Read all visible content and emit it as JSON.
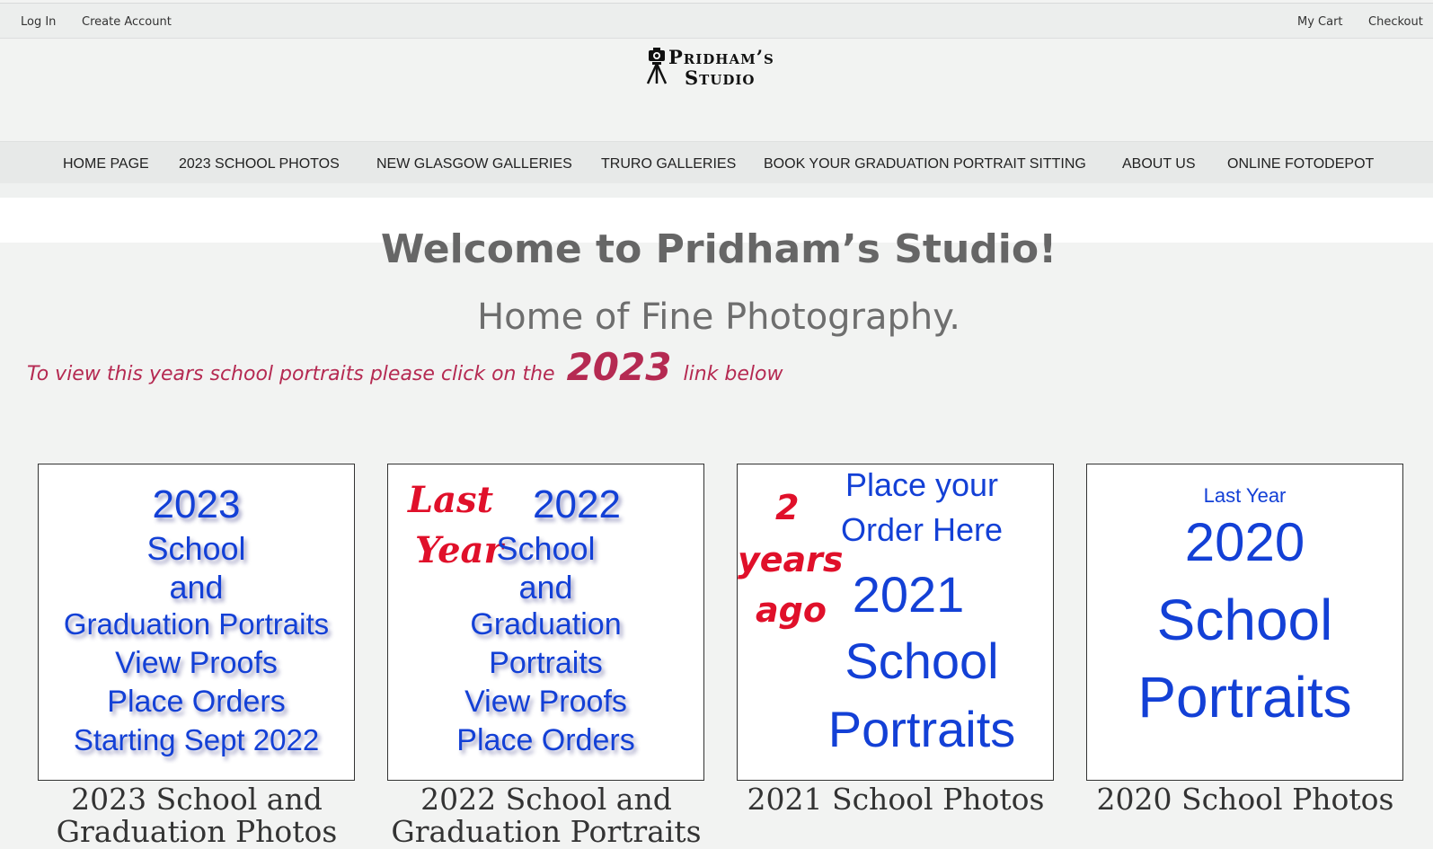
{
  "topbar": {
    "login": "Log In",
    "create_account": "Create Account",
    "cart": "My Cart",
    "checkout": "Checkout"
  },
  "logo": {
    "line1": "Pridham’s",
    "line2": "Studio"
  },
  "nav": [
    {
      "label": "HOME PAGE"
    },
    {
      "label": "2023 SCHOOL PHOTOS"
    },
    {
      "label": "NEW GLASGOW GALLERIES"
    },
    {
      "label": "TRURO GALLERIES"
    },
    {
      "label": "BOOK YOUR GRADUATION PORTRAIT SITTING"
    },
    {
      "label": "ABOUT US"
    },
    {
      "label": "ONLINE FOTODEPOT"
    }
  ],
  "hero": {
    "title": "Welcome to Pridham’s Studio!",
    "subtitle": "Home of Fine Photography.",
    "instruction_pre": "To view this years school portraits please click on the",
    "instruction_year": "2023",
    "instruction_post": "link below"
  },
  "cards": [
    {
      "lines": [
        "2023",
        "School",
        "and",
        "Graduation Portraits",
        "View Proofs",
        "Place Orders",
        "Starting Sept 2022"
      ],
      "caption": "2023 School and Graduation Photos"
    },
    {
      "badge": [
        "Last",
        "Year"
      ],
      "lines": [
        "2022",
        "School",
        "and",
        "Graduation",
        "Portraits",
        "View Proofs",
        "Place Orders"
      ],
      "caption": "2022 School and Graduation Portraits"
    },
    {
      "badge": [
        "2",
        "years",
        "ago"
      ],
      "lines": [
        "Place your",
        "Order Here",
        "2021",
        "School",
        "Portraits"
      ],
      "caption": "2021 School Photos"
    },
    {
      "lines": [
        "Last Year",
        "2020",
        "School",
        "Portraits"
      ],
      "caption": "2020 School Photos"
    }
  ],
  "colors": {
    "accent_blue": "#1340d6",
    "accent_red": "#e0102a",
    "instruction_text": "#b52a52"
  }
}
